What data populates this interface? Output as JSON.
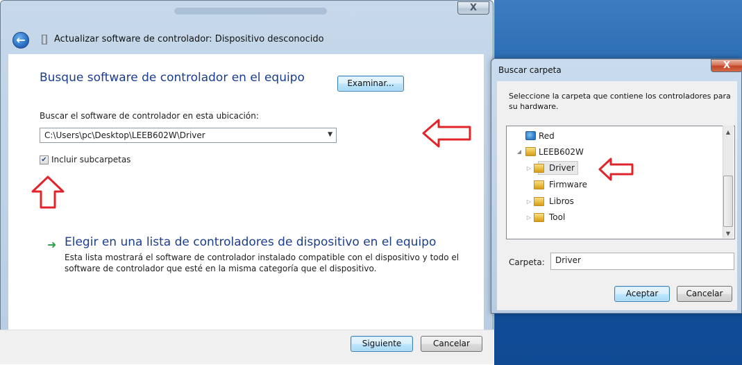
{
  "wizard": {
    "title": "Actualizar software de controlador: Dispositivo desconocido",
    "close_label": "X",
    "heading": "Busque software de controlador en el equipo",
    "location_label": "Buscar el software de controlador en esta ubicación:",
    "path_value": "C:\\Users\\pc\\Desktop\\LEEB602W\\Driver",
    "browse_label": "Examinar...",
    "include_subfolders_label": "Incluir subcarpetas",
    "include_subfolders_checked": true,
    "choose_list_label": "Elegir en una lista de controladores de dispositivo en el equipo",
    "choose_list_description": "Esta lista mostrará el software de controlador instalado compatible con el dispositivo y todo el software de controlador que esté en la misma categoría que el dispositivo.",
    "next_label": "Siguiente",
    "cancel_label": "Cancelar"
  },
  "browse_dialog": {
    "title": "Buscar carpeta",
    "close_label": "X",
    "instruction": "Seleccione la carpeta que contiene los controladores para su hardware.",
    "tree": [
      {
        "label": "Red",
        "icon": "network-icon",
        "expander": "collapsed"
      },
      {
        "label": "LEEB602W",
        "icon": "folder-icon",
        "expander": "expanded"
      },
      {
        "label": "Driver",
        "icon": "folder-icon",
        "expander": "collapsed",
        "selected": true
      },
      {
        "label": "Firmware",
        "icon": "folder-icon",
        "expander": "none"
      },
      {
        "label": "Libros",
        "icon": "folder-icon",
        "expander": "collapsed"
      },
      {
        "label": "Tool",
        "icon": "folder-icon",
        "expander": "collapsed"
      }
    ],
    "folder_label": "Carpeta:",
    "folder_value": "Driver",
    "ok_label": "Aceptar",
    "cancel_label": "Cancelar"
  },
  "colors": {
    "heading_blue": "#1b3d8f",
    "annotation_red": "#e0242a",
    "link_arrow_green": "#2ea24a"
  }
}
